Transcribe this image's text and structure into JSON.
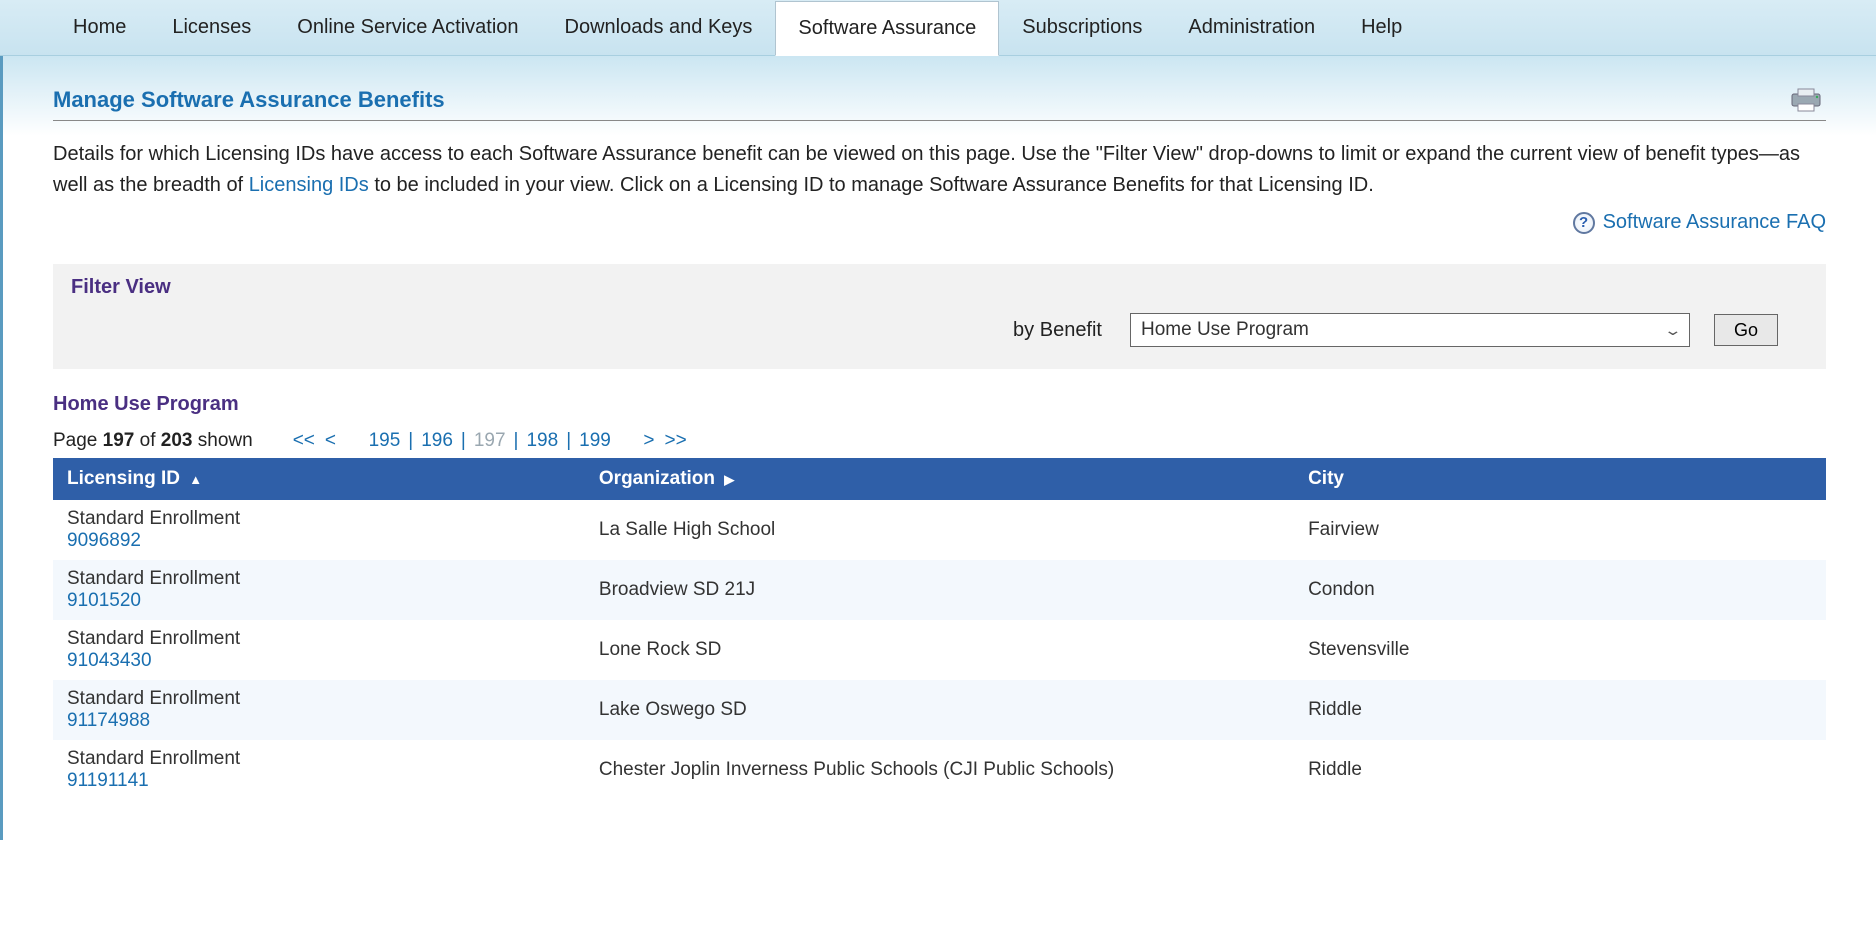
{
  "nav": {
    "items": [
      {
        "label": "Home"
      },
      {
        "label": "Licenses"
      },
      {
        "label": "Online Service Activation"
      },
      {
        "label": "Downloads and Keys"
      },
      {
        "label": "Software Assurance"
      },
      {
        "label": "Subscriptions"
      },
      {
        "label": "Administration"
      },
      {
        "label": "Help"
      }
    ],
    "active_index": 4
  },
  "page": {
    "title": "Manage Software Assurance Benefits",
    "intro_before_link": "Details for which Licensing IDs have access to each Software Assurance benefit can be viewed on this page. Use the \"Filter View\" drop-downs to limit or expand the current view of benefit types—as well as the breadth of ",
    "intro_link_text": "Licensing IDs",
    "intro_after_link": " to be included in your view. Click on a Licensing ID to manage Software Assurance Benefits for that Licensing ID.",
    "faq_label": "Software Assurance FAQ"
  },
  "filter": {
    "panel_title": "Filter View",
    "by_label": "by Benefit",
    "selected": "Home Use Program",
    "go_label": "Go"
  },
  "section": {
    "title": "Home Use Program"
  },
  "pager": {
    "page_word": "Page",
    "current": "197",
    "of_word": "of",
    "total": "203",
    "shown_word": "shown",
    "first": "<<",
    "prev": "<",
    "next": ">",
    "last": ">>",
    "pages": [
      "195",
      "196",
      "197",
      "198",
      "199"
    ]
  },
  "table": {
    "headers": {
      "licensing_id": "Licensing ID",
      "organization": "Organization",
      "city": "City"
    },
    "sort_indicator_lic": "▲",
    "sort_indicator_org": "▶",
    "rows": [
      {
        "type": "Standard Enrollment",
        "id": "9096892",
        "org": "La Salle High School",
        "city": "Fairview"
      },
      {
        "type": "Standard Enrollment",
        "id": "9101520",
        "org": "Broadview SD 21J",
        "city": "Condon"
      },
      {
        "type": "Standard Enrollment",
        "id": "91043430",
        "org": "Lone Rock SD",
        "city": "Stevensville"
      },
      {
        "type": "Standard Enrollment",
        "id": "91174988",
        "org": "Lake Oswego SD",
        "city": "Riddle"
      },
      {
        "type": "Standard Enrollment",
        "id": "91191141",
        "org": "Chester Joplin Inverness Public Schools (CJI Public Schools)",
        "city": "Riddle"
      }
    ]
  }
}
